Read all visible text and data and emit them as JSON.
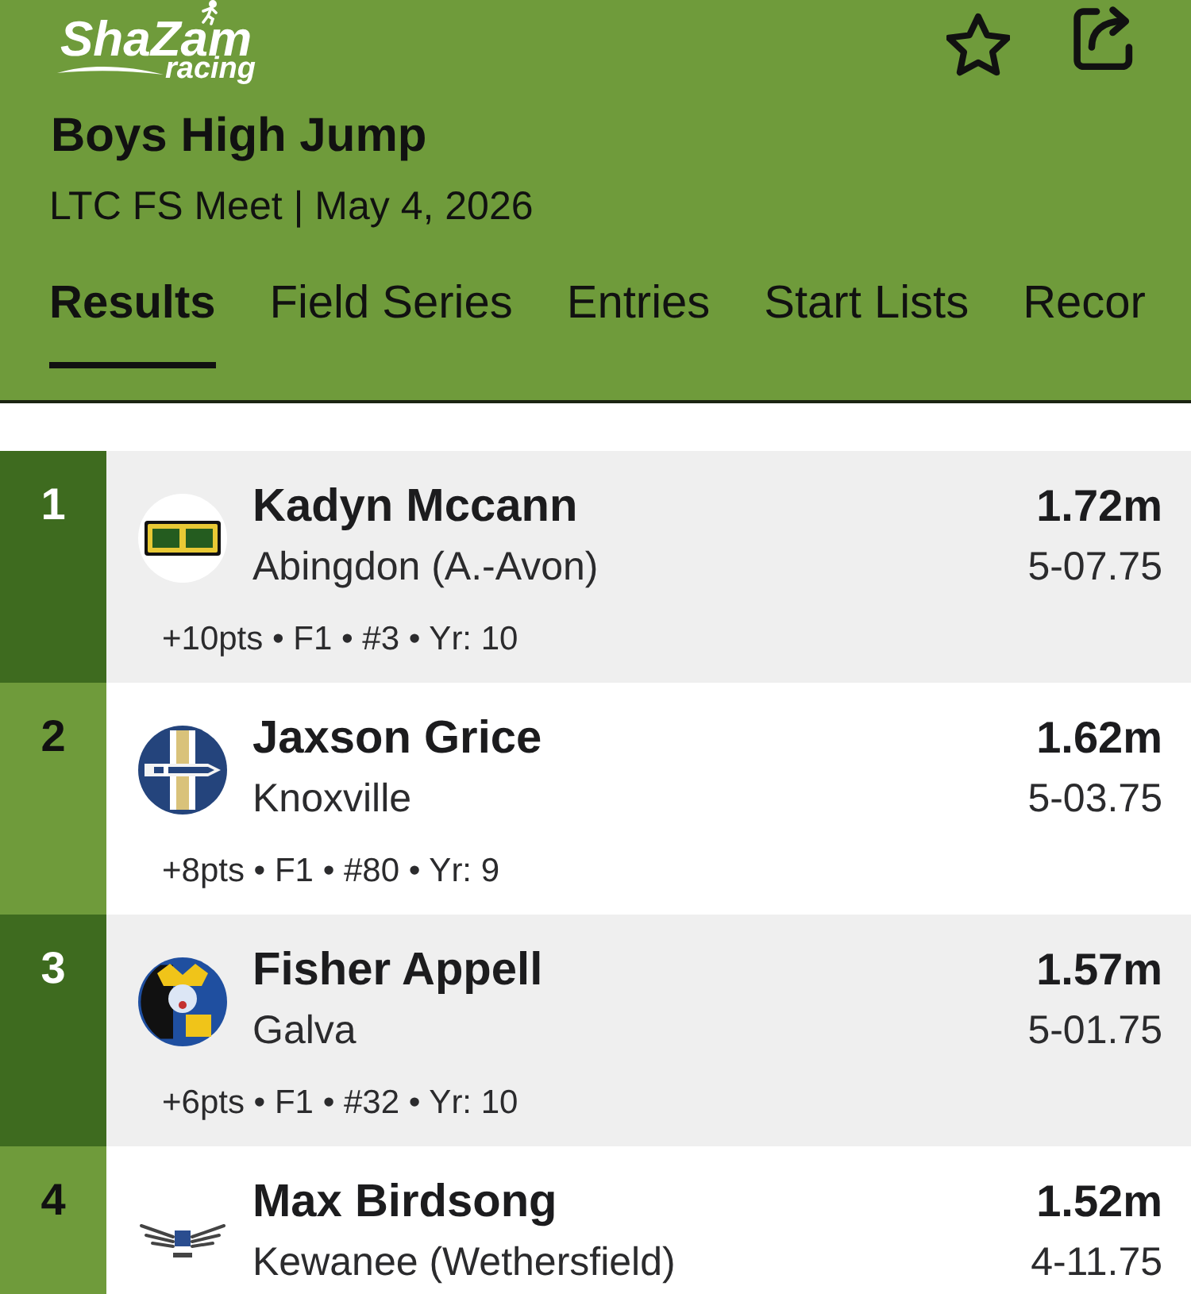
{
  "header": {
    "brand": {
      "name": "ShaZam",
      "tagline": "racing"
    },
    "title": "Boys High Jump",
    "subtitle": "LTC FS Meet | May 4, 2026"
  },
  "tabs": [
    {
      "label": "Results",
      "selected": true
    },
    {
      "label": "Field Series",
      "selected": false
    },
    {
      "label": "Entries",
      "selected": false
    },
    {
      "label": "Start Lists",
      "selected": false
    },
    {
      "label": "Recor",
      "selected": false
    }
  ],
  "results": [
    {
      "rank": "1",
      "name": "Kadyn Mccann",
      "school": "Abingdon (A.-Avon)",
      "meta": "+10pts • F1 • #3 • Yr: 10",
      "mark": "1.72m",
      "imperial": "5-07.75"
    },
    {
      "rank": "2",
      "name": "Jaxson Grice",
      "school": "Knoxville",
      "meta": "+8pts • F1 • #80 • Yr: 9",
      "mark": "1.62m",
      "imperial": "5-03.75"
    },
    {
      "rank": "3",
      "name": "Fisher Appell",
      "school": "Galva",
      "meta": "+6pts • F1 • #32 • Yr: 10",
      "mark": "1.57m",
      "imperial": "5-01.75"
    },
    {
      "rank": "4",
      "name": "Max Birdsong",
      "school": "Kewanee (Wethersfield)",
      "mark": "1.52m",
      "imperial": "4-11.75"
    }
  ]
}
